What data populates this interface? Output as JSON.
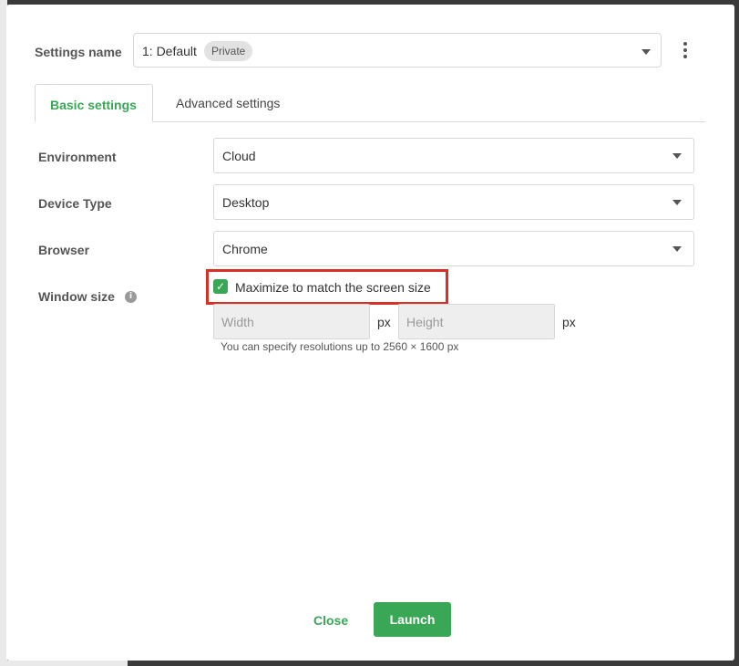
{
  "settings": {
    "label": "Settings name",
    "selected_value": "1: Default",
    "badge": "Private",
    "menu_icon": "kebab-menu-icon"
  },
  "tabs": [
    {
      "label": "Basic settings",
      "active": true
    },
    {
      "label": "Advanced settings",
      "active": false
    }
  ],
  "form": {
    "environment": {
      "label": "Environment",
      "value": "Cloud"
    },
    "device_type": {
      "label": "Device Type",
      "value": "Desktop"
    },
    "browser": {
      "label": "Browser",
      "value": "Chrome"
    },
    "window_size": {
      "label": "Window size",
      "info_icon": "info-icon",
      "maximize_label": "Maximize to match the screen size",
      "maximize_checked": true,
      "width_placeholder": "Width",
      "height_placeholder": "Height",
      "unit": "px",
      "hint": "You can specify resolutions up to 2560 × 1600 px"
    }
  },
  "footer": {
    "close_label": "Close",
    "launch_label": "Launch"
  },
  "colors": {
    "accent": "#3aa757",
    "highlight": "#d93025"
  }
}
